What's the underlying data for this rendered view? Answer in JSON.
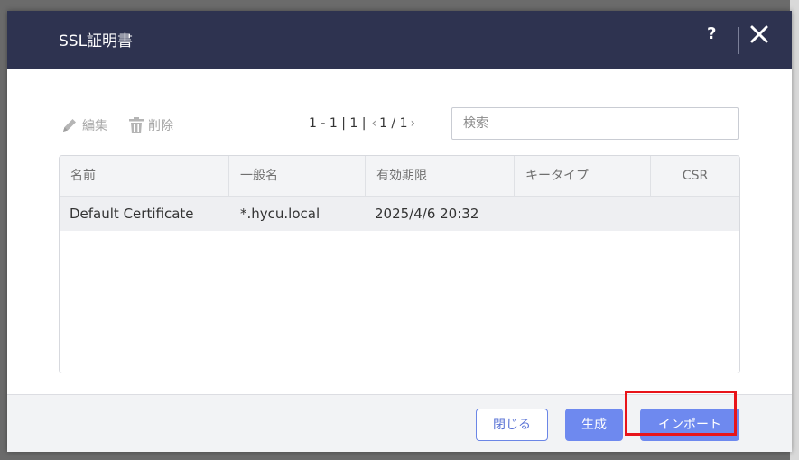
{
  "dialog": {
    "title": "SSL証明書",
    "help_label": "?"
  },
  "toolbar": {
    "edit_label": "編集",
    "delete_label": "削除"
  },
  "pager": {
    "range": "1 - 1 | 1 |",
    "prev": "‹",
    "page": "1 / 1",
    "next": "›"
  },
  "search": {
    "placeholder": "検索",
    "value": ""
  },
  "table": {
    "columns": [
      "名前",
      "一般名",
      "有効期限",
      "キータイプ",
      "CSR"
    ],
    "rows": [
      {
        "name": "Default Certificate",
        "common_name": "*.hycu.local",
        "expiry": "2025/4/6 20:32",
        "key_type": "",
        "csr": ""
      }
    ]
  },
  "footer": {
    "close_label": "閉じる",
    "generate_label": "生成",
    "import_label": "インポート"
  },
  "colors": {
    "header_bg": "#2e3350",
    "primary": "#6e89ef",
    "highlight": "#e8141a"
  },
  "icons": [
    "pencil-icon",
    "trash-icon",
    "close-icon"
  ]
}
